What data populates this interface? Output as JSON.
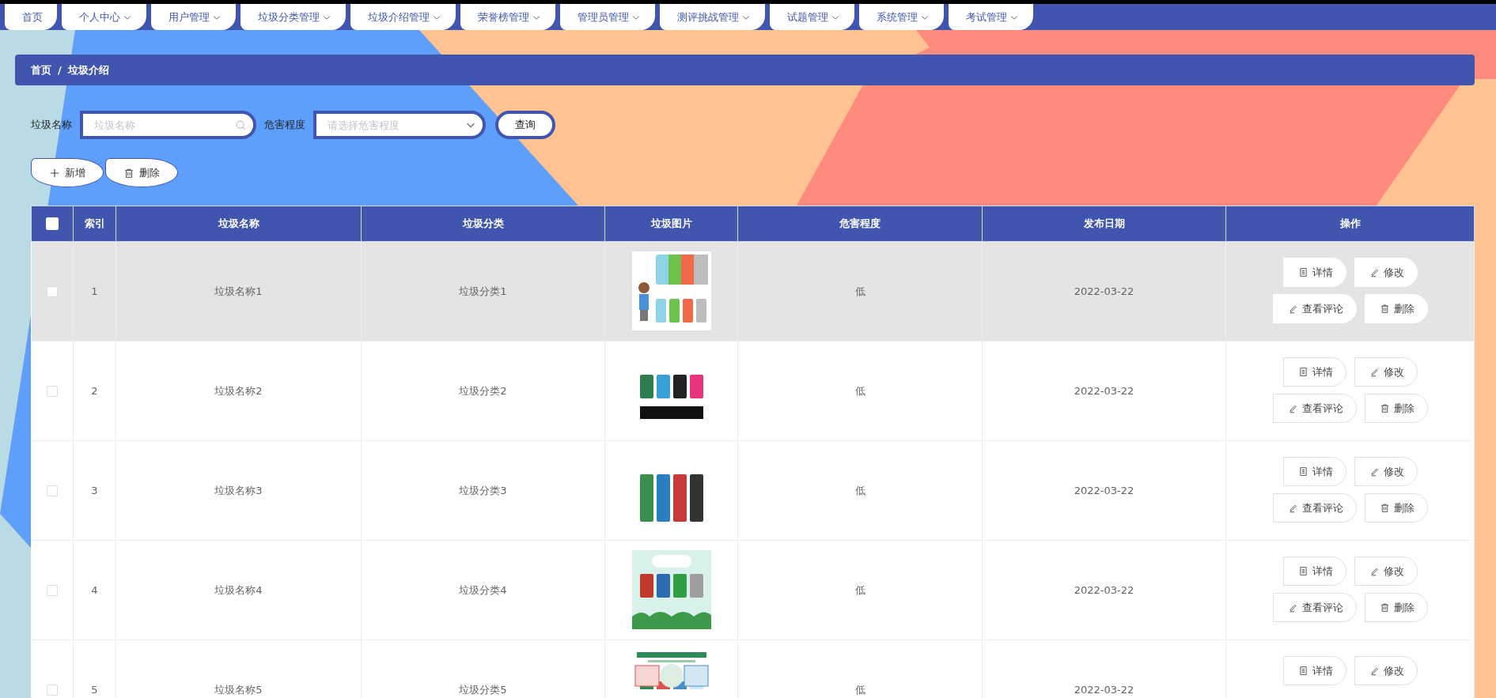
{
  "nav": [
    {
      "label": "首页",
      "has_menu": false
    },
    {
      "label": "个人中心",
      "has_menu": true
    },
    {
      "label": "用户管理",
      "has_menu": true
    },
    {
      "label": "垃圾分类管理",
      "has_menu": true
    },
    {
      "label": "垃圾介绍管理",
      "has_menu": true
    },
    {
      "label": "荣誉榜管理",
      "has_menu": true
    },
    {
      "label": "管理员管理",
      "has_menu": true
    },
    {
      "label": "测评挑战管理",
      "has_menu": true
    },
    {
      "label": "试题管理",
      "has_menu": true
    },
    {
      "label": "系统管理",
      "has_menu": true
    },
    {
      "label": "考试管理",
      "has_menu": true
    }
  ],
  "breadcrumb": {
    "items": [
      "首页",
      "垃圾介绍"
    ],
    "separator": "/"
  },
  "search": {
    "fields": [
      {
        "kind": "text",
        "label": "垃圾名称",
        "placeholder": "垃圾名称"
      },
      {
        "kind": "select",
        "label": "危害程度",
        "placeholder": "请选择危害程度"
      }
    ],
    "button": "查询"
  },
  "toolbar": [
    {
      "kind": "add",
      "label": "新增"
    },
    {
      "kind": "delete",
      "label": "删除"
    }
  ],
  "table": {
    "all_selected": false,
    "columns": [
      "索引",
      "垃圾名称",
      "垃圾分类",
      "垃圾图片",
      "危害程度",
      "发布日期",
      "操作"
    ],
    "rows": [
      {
        "selected": false,
        "hovered": true,
        "index": "1",
        "name": "垃圾名称1",
        "category": "垃圾分类1",
        "image": {
          "kind": "picture"
        },
        "hazard": "低",
        "date": "2022-03-22",
        "actions": [
          {
            "kind": "detail",
            "label": "详情"
          },
          {
            "kind": "edit",
            "label": "修改"
          },
          {
            "kind": "comment",
            "label": "查看评论"
          },
          {
            "kind": "delete",
            "label": "删除"
          }
        ]
      },
      {
        "selected": false,
        "hovered": false,
        "index": "2",
        "name": "垃圾名称2",
        "category": "垃圾分类2",
        "image": {
          "kind": "picture"
        },
        "hazard": "低",
        "date": "2022-03-22",
        "actions": [
          {
            "kind": "detail",
            "label": "详情"
          },
          {
            "kind": "edit",
            "label": "修改"
          },
          {
            "kind": "comment",
            "label": "查看评论"
          },
          {
            "kind": "delete",
            "label": "删除"
          }
        ]
      },
      {
        "selected": false,
        "hovered": false,
        "index": "3",
        "name": "垃圾名称3",
        "category": "垃圾分类3",
        "image": {
          "kind": "picture"
        },
        "hazard": "低",
        "date": "2022-03-22",
        "actions": [
          {
            "kind": "detail",
            "label": "详情"
          },
          {
            "kind": "edit",
            "label": "修改"
          },
          {
            "kind": "comment",
            "label": "查看评论"
          },
          {
            "kind": "delete",
            "label": "删除"
          }
        ]
      },
      {
        "selected": false,
        "hovered": false,
        "index": "4",
        "name": "垃圾名称4",
        "category": "垃圾分类4",
        "image": {
          "kind": "picture"
        },
        "hazard": "低",
        "date": "2022-03-22",
        "actions": [
          {
            "kind": "detail",
            "label": "详情"
          },
          {
            "kind": "edit",
            "label": "修改"
          },
          {
            "kind": "comment",
            "label": "查看评论"
          },
          {
            "kind": "delete",
            "label": "删除"
          }
        ]
      },
      {
        "selected": false,
        "hovered": false,
        "index": "5",
        "name": "垃圾名称5",
        "category": "垃圾分类5",
        "image": {
          "kind": "picture"
        },
        "hazard": "低",
        "date": "2022-03-22",
        "actions": [
          {
            "kind": "detail",
            "label": "详情"
          },
          {
            "kind": "edit",
            "label": "修改"
          }
        ]
      }
    ]
  }
}
